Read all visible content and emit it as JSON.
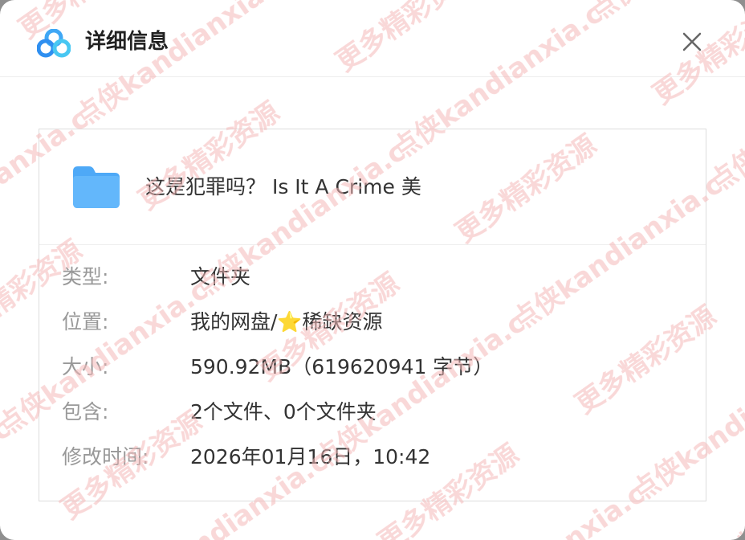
{
  "dialog": {
    "title": "详细信息",
    "close_label": "×"
  },
  "file": {
    "name": "这是犯罪吗？ Is It A Crime 美",
    "icon": "folder-icon"
  },
  "details": [
    {
      "label": "类型:",
      "value": "文件夹"
    },
    {
      "label": "位置:",
      "value": "我的网盘/⭐稀缺资源"
    },
    {
      "label": "大小:",
      "value": "590.92MB（619620941 字节）"
    },
    {
      "label": "包含:",
      "value": "2个文件、0个文件夹"
    },
    {
      "label": "修改时间:",
      "value": "2026年01月16日，10:42"
    }
  ],
  "watermark": {
    "text": "更多精彩资源 看点侠kandianxia.com",
    "color": "#f2b0b0"
  },
  "colors": {
    "title": "#222222",
    "label": "#999999",
    "value": "#333333",
    "folder": "#4ea9f7"
  }
}
